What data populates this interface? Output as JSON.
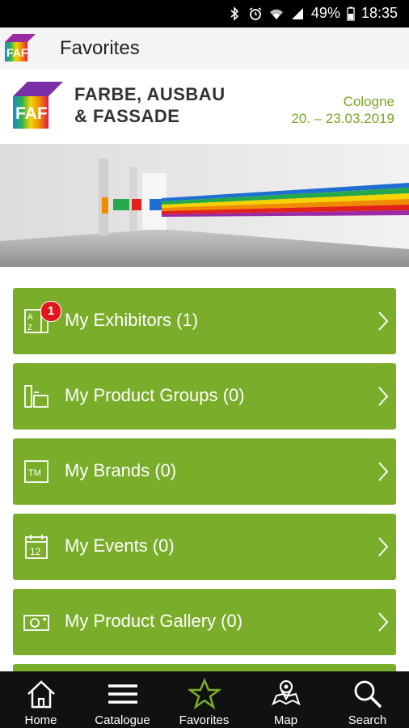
{
  "status_bar": {
    "battery": "49%",
    "time": "18:35"
  },
  "app_bar": {
    "title": "Favorites"
  },
  "banner": {
    "name_line1": "FARBE, AUSBAU",
    "name_line2": "& FASSADE",
    "city": "Cologne",
    "dates": "20. – 23.03.2019"
  },
  "menu": {
    "items": [
      {
        "label": "My Exhibitors (1)",
        "icon": "az-list-icon",
        "badge": "1"
      },
      {
        "label": "My Product Groups (0)",
        "icon": "product-groups-icon"
      },
      {
        "label": "My Brands (0)",
        "icon": "trademark-icon"
      },
      {
        "label": "My Events (0)",
        "icon": "calendar-icon",
        "icon_text": "12"
      },
      {
        "label": "My Product Gallery (0)",
        "icon": "camera-icon"
      }
    ],
    "accent": "#7aad2a"
  },
  "bottom_nav": {
    "items": [
      {
        "label": "Home",
        "icon": "home-icon"
      },
      {
        "label": "Catalogue",
        "icon": "menu-icon"
      },
      {
        "label": "Favorites",
        "icon": "star-icon",
        "active": true
      },
      {
        "label": "Map",
        "icon": "map-icon"
      },
      {
        "label": "Search",
        "icon": "search-icon"
      }
    ]
  }
}
